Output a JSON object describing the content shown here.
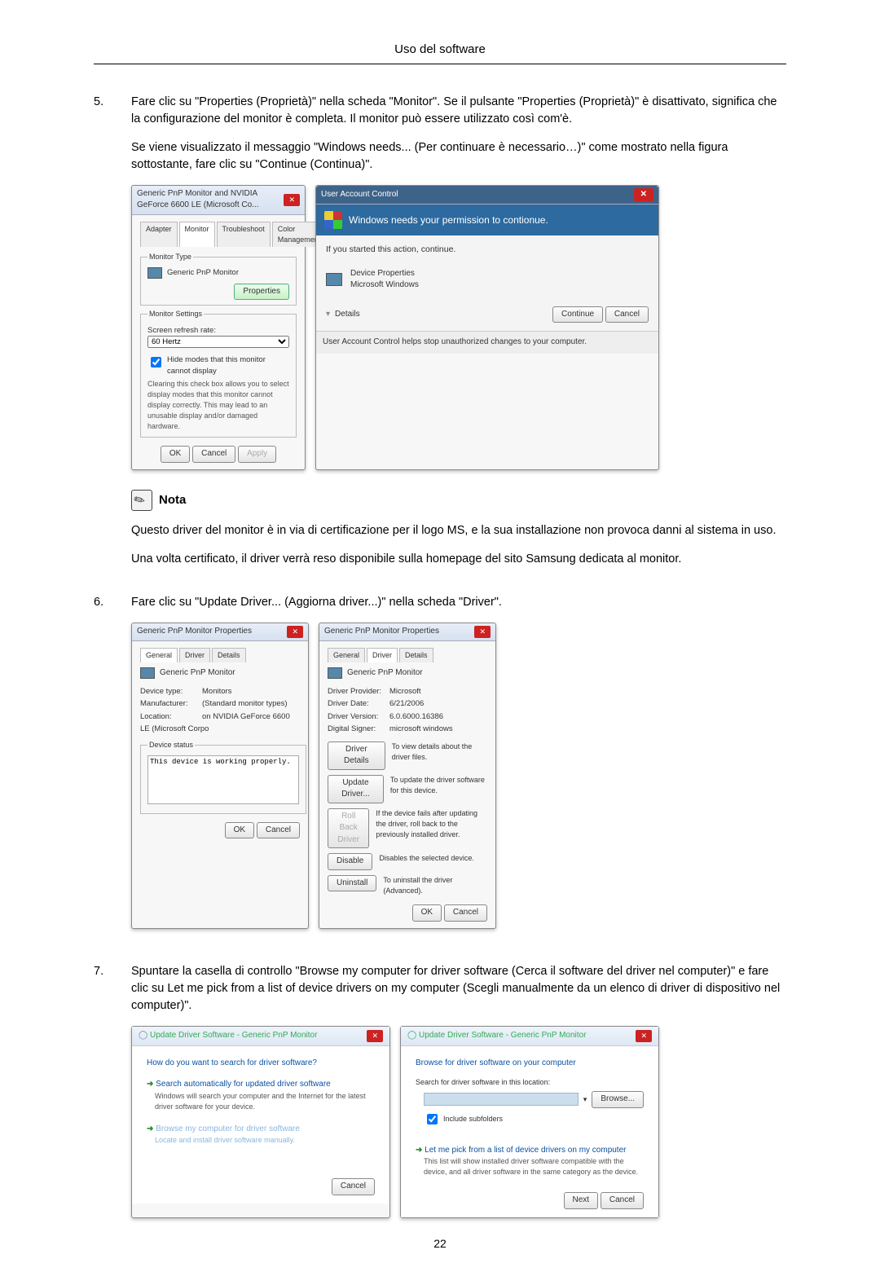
{
  "header": {
    "title": "Uso del software"
  },
  "steps": {
    "s5": {
      "num": "5.",
      "p1": "Fare clic su \"Properties (Proprietà)\" nella scheda \"Monitor\". Se il pulsante \"Properties (Proprietà)\" è disattivato, significa che la configurazione del monitor è completa. Il monitor può essere utilizzato così com'è.",
      "p2": "Se viene visualizzato il messaggio \"Windows needs... (Per continuare è necessario…)\" come mostrato nella figura sottostante, fare clic su \"Continue (Continua)\"."
    },
    "s6": {
      "num": "6.",
      "p1": "Fare clic su \"Update Driver... (Aggiorna driver...)\" nella scheda \"Driver\"."
    },
    "s7": {
      "num": "7.",
      "p1": "Spuntare la casella di controllo \"Browse my computer for driver software (Cerca il software del driver nel computer)\" e fare clic su Let me pick from a list of device drivers on my computer (Scegli manualmente da un elenco di driver di dispositivo nel computer)\"."
    }
  },
  "note": {
    "label": "Nota",
    "p1": "Questo driver del monitor è in via di certificazione per il logo MS, e la sua installazione non provoca danni al sistema in uso.",
    "p2": "Una volta certificato, il driver verrà reso disponibile sulla homepage del sito Samsung dedicata al monitor."
  },
  "fig1": {
    "left": {
      "title": "Generic PnP Monitor and NVIDIA GeForce 6600 LE (Microsoft Co...",
      "tabs": {
        "t1": "Adapter",
        "t2": "Monitor",
        "t3": "Troubleshoot",
        "t4": "Color Management"
      },
      "monitor_type_legend": "Monitor Type",
      "monitor_type": "Generic PnP Monitor",
      "properties_btn": "Properties",
      "settings_legend": "Monitor Settings",
      "refresh_lbl": "Screen refresh rate:",
      "refresh_val": "60 Hertz",
      "hide_chk": "Hide modes that this monitor cannot display",
      "hide_note": "Clearing this check box allows you to select display modes that this monitor cannot display correctly. This may lead to an unusable display and/or damaged hardware.",
      "ok": "OK",
      "cancel": "Cancel",
      "apply": "Apply"
    },
    "right": {
      "title": "User Account Control",
      "banner": "Windows needs your permission to contionue.",
      "started": "If you started this action, continue.",
      "dev1": "Device Properties",
      "dev2": "Microsoft Windows",
      "details": "Details",
      "continue": "Continue",
      "cancel": "Cancel",
      "footer": "User Account Control helps stop unauthorized changes to your computer."
    }
  },
  "fig2": {
    "left": {
      "title": "Generic PnP Monitor Properties",
      "tabs": {
        "t1": "General",
        "t2": "Driver",
        "t3": "Details"
      },
      "name": "Generic PnP Monitor",
      "dt_k": "Device type:",
      "dt_v": "Monitors",
      "mf_k": "Manufacturer:",
      "mf_v": "(Standard monitor types)",
      "lo_k": "Location:",
      "lo_v": "on NVIDIA GeForce 6600 LE (Microsoft Corpo",
      "status_legend": "Device status",
      "status": "This device is working properly.",
      "ok": "OK",
      "cancel": "Cancel"
    },
    "right": {
      "title": "Generic PnP Monitor Properties",
      "tabs": {
        "t1": "General",
        "t2": "Driver",
        "t3": "Details"
      },
      "name": "Generic PnP Monitor",
      "dp_k": "Driver Provider:",
      "dp_v": "Microsoft",
      "dd_k": "Driver Date:",
      "dd_v": "6/21/2006",
      "dv_k": "Driver Version:",
      "dv_v": "6.0.6000.16386",
      "ds_k": "Digital Signer:",
      "ds_v": "microsoft windows",
      "b_details": "Driver Details",
      "d_details": "To view details about the driver files.",
      "b_update": "Update Driver...",
      "d_update": "To update the driver software for this device.",
      "b_roll": "Roll Back Driver",
      "d_roll": "If the device fails after updating the driver, roll back to the previously installed driver.",
      "b_disable": "Disable",
      "d_disable": "Disables the selected device.",
      "b_uninstall": "Uninstall",
      "d_uninstall": "To uninstall the driver (Advanced).",
      "ok": "OK",
      "cancel": "Cancel"
    }
  },
  "fig3": {
    "left": {
      "crumb": "Update Driver Software - Generic PnP Monitor",
      "heading": "How do you want to search for driver software?",
      "opt1": "Search automatically for updated driver software",
      "opt1_sub": "Windows will search your computer and the Internet for the latest driver software for your device.",
      "opt2": "Browse my computer for driver software",
      "opt2_sub": "Locate and install driver software manually.",
      "cancel": "Cancel"
    },
    "right": {
      "crumb": "Update Driver Software - Generic PnP Monitor",
      "heading": "Browse for driver software on your computer",
      "loc_lbl": "Search for driver software in this location:",
      "browse": "Browse...",
      "include": "Include subfolders",
      "let_me": "Let me pick from a list of device drivers on my computer",
      "let_me_sub": "This list will show installed driver software compatible with the device, and all driver software in the same category as the device.",
      "next": "Next",
      "cancel": "Cancel"
    }
  },
  "page_number": "22"
}
